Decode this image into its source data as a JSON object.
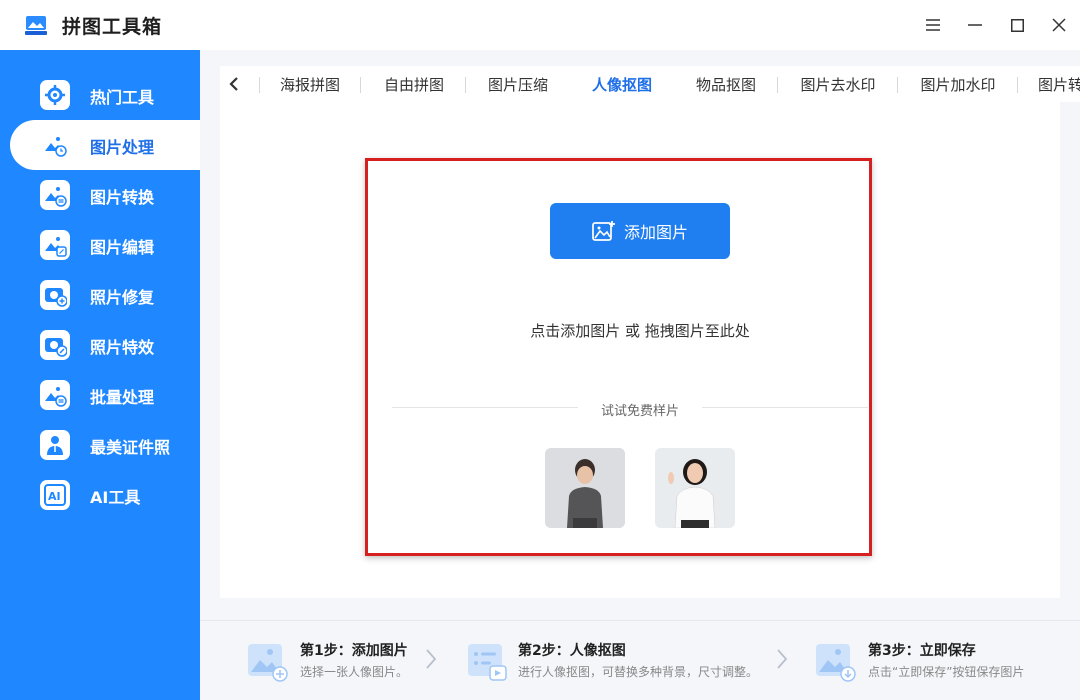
{
  "app": {
    "title": "拼图工具箱",
    "logo_icon": "app-logo-icon"
  },
  "window_controls": {
    "menu": "≡",
    "minimize": "—",
    "maximize": "□",
    "close": "✕"
  },
  "sidebar": {
    "items": [
      {
        "label": "热门工具",
        "icon": "settings-icon",
        "active": false
      },
      {
        "label": "图片处理",
        "icon": "image-clock-icon",
        "active": true
      },
      {
        "label": "图片转换",
        "icon": "image-convert-icon",
        "active": false
      },
      {
        "label": "图片编辑",
        "icon": "image-edit-icon",
        "active": false
      },
      {
        "label": "照片修复",
        "icon": "camera-plus-icon",
        "active": false
      },
      {
        "label": "照片特效",
        "icon": "camera-wand-icon",
        "active": false
      },
      {
        "label": "批量处理",
        "icon": "image-batch-icon",
        "active": false
      },
      {
        "label": "最美证件照",
        "icon": "id-photo-icon",
        "active": false
      },
      {
        "label": "AI工具",
        "icon": "ai-icon",
        "active": false
      }
    ]
  },
  "tabs": {
    "back_icon": "chevron-left-icon",
    "items": [
      {
        "label": "海报拼图",
        "active": false
      },
      {
        "label": "自由拼图",
        "active": false
      },
      {
        "label": "图片压缩",
        "active": false
      },
      {
        "label": "人像抠图",
        "active": true
      },
      {
        "label": "物品抠图",
        "active": false
      },
      {
        "label": "图片去水印",
        "active": false
      },
      {
        "label": "图片加水印",
        "active": false
      },
      {
        "label": "图片转",
        "active": false
      }
    ]
  },
  "upload": {
    "add_button_label": "添加图片",
    "hint": "点击添加图片 或 拖拽图片至此处",
    "samples_label": "试试免费样片"
  },
  "steps": [
    {
      "title": "第1步：添加图片",
      "desc": "选择一张人像图片。"
    },
    {
      "title": "第2步：人像抠图",
      "desc": "进行人像抠图，可替换多种背景，尺寸调整。"
    },
    {
      "title": "第3步：立即保存",
      "desc": "点击“立即保存”按钮保存图片"
    }
  ],
  "colors": {
    "accent": "#1f87ff",
    "button": "#1f7ff0",
    "highlight": "#d61f1f"
  }
}
